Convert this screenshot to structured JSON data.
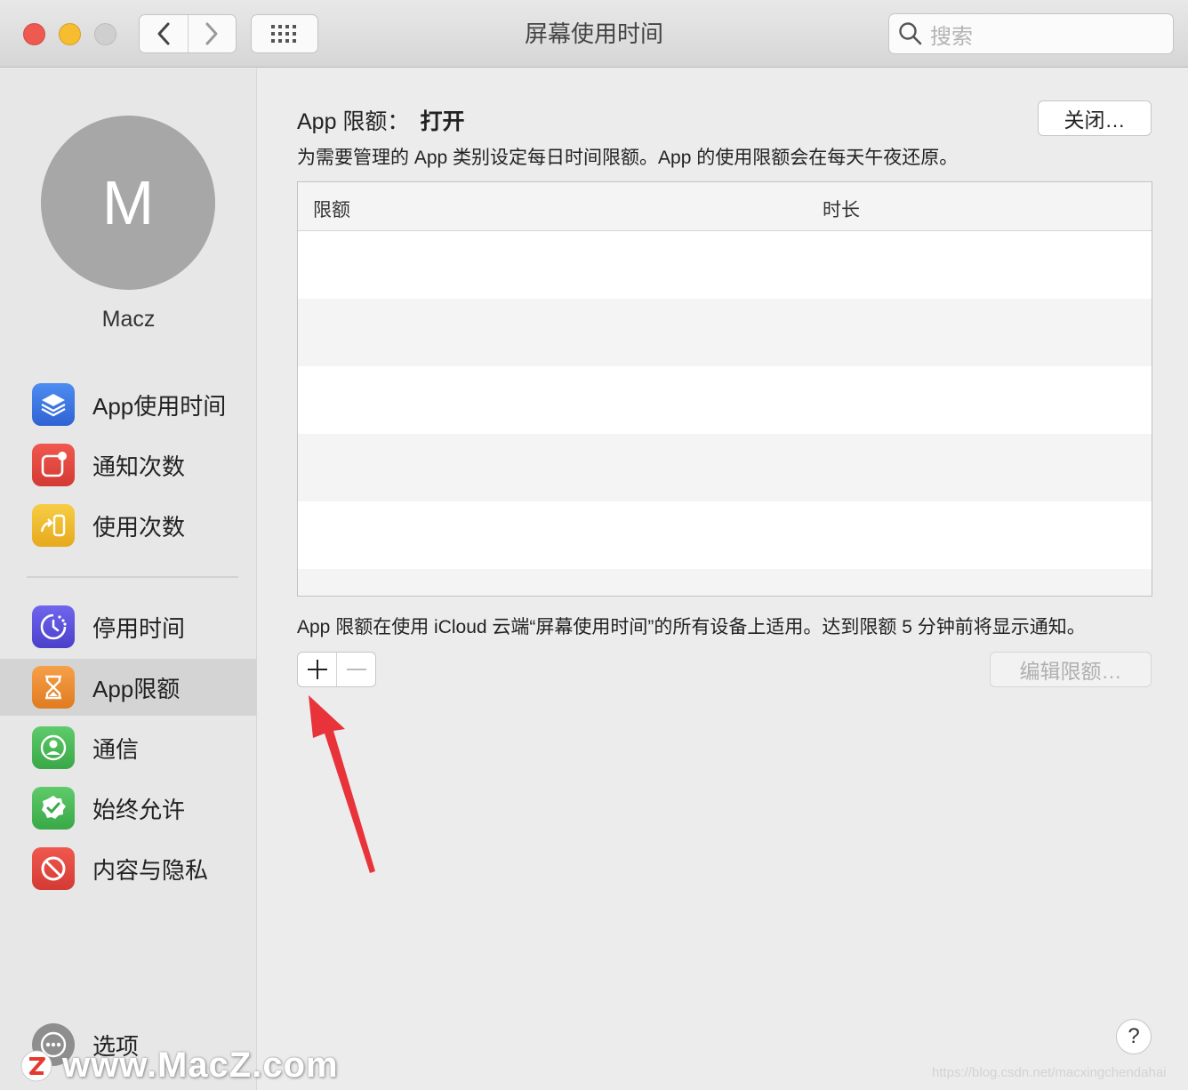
{
  "window": {
    "title": "屏幕使用时间",
    "search_placeholder": "搜索"
  },
  "user": {
    "initial": "M",
    "name": "Macz"
  },
  "sidebar": {
    "items": [
      {
        "label": "App使用时间",
        "icon": "stack-layers-icon",
        "color": "#3a74e0"
      },
      {
        "label": "通知次数",
        "icon": "notification-badge-icon",
        "color": "#e0433b"
      },
      {
        "label": "使用次数",
        "icon": "pickup-phone-icon",
        "color": "#f0b928"
      },
      {
        "label": "停用时间",
        "icon": "downtime-clock-icon",
        "color": "#5d52d8"
      },
      {
        "label": "App限额",
        "icon": "hourglass-icon",
        "color": "#ef8a2e",
        "active": true
      },
      {
        "label": "通信",
        "icon": "contact-person-icon",
        "color": "#4cb85a"
      },
      {
        "label": "始终允许",
        "icon": "checkmark-seal-icon",
        "color": "#4cb85a"
      },
      {
        "label": "内容与隐私",
        "icon": "no-entry-icon",
        "color": "#e0433b"
      }
    ],
    "options_label": "选项"
  },
  "main": {
    "heading_label": "App 限额：",
    "heading_status": "打开",
    "close_button": "关闭…",
    "description": "为需要管理的 App 类别设定每日时间限额。App 的使用限额会在每天午夜还原。",
    "table": {
      "columns": [
        "限额",
        "时长"
      ],
      "rows": []
    },
    "footnote": "App 限额在使用 iCloud 云端“屏幕使用时间”的所有设备上适用。达到限额 5 分钟前将显示通知。",
    "add_button": "+",
    "remove_button": "−",
    "edit_button": "编辑限额…",
    "help_button": "?"
  },
  "watermarks": {
    "brand": "www.MacZ.com",
    "url": "https://blog.csdn.net/macxingchendahai"
  },
  "colors": {
    "accent_arrow": "#e8333a",
    "active_row": "#d4d4d4"
  }
}
